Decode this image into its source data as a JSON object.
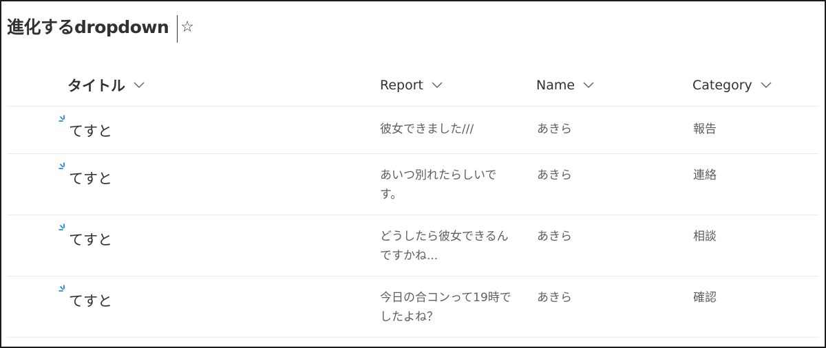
{
  "list": {
    "title": "進化するdropdown",
    "favorite_icon": "☆"
  },
  "columns": [
    {
      "label": "タイトル",
      "icon": "chevron-down-icon"
    },
    {
      "label": "Report",
      "icon": "chevron-down-icon"
    },
    {
      "label": "Name",
      "icon": "chevron-down-icon"
    },
    {
      "label": "Category",
      "icon": "chevron-down-icon"
    }
  ],
  "rows": [
    {
      "title": "てすと",
      "report": "彼女できました///",
      "name": "あきら",
      "category": "報告",
      "new_icon": "new-item-sparkle-icon"
    },
    {
      "title": "てすと",
      "report": "あいつ別れたらしいです。",
      "name": "あきら",
      "category": "連絡",
      "new_icon": "new-item-sparkle-icon"
    },
    {
      "title": "てすと",
      "report": "どうしたら彼女できるんですかね...",
      "name": "あきら",
      "category": "相談",
      "new_icon": "new-item-sparkle-icon"
    },
    {
      "title": "てすと",
      "report": "今日の合コンって19時でしたよね？",
      "name": "あきら",
      "category": "確認",
      "new_icon": "new-item-sparkle-icon"
    }
  ],
  "colors": {
    "new_indicator": "#0078d4",
    "text": "#323130",
    "subtext": "#605e5c",
    "divider": "#edebe9"
  }
}
